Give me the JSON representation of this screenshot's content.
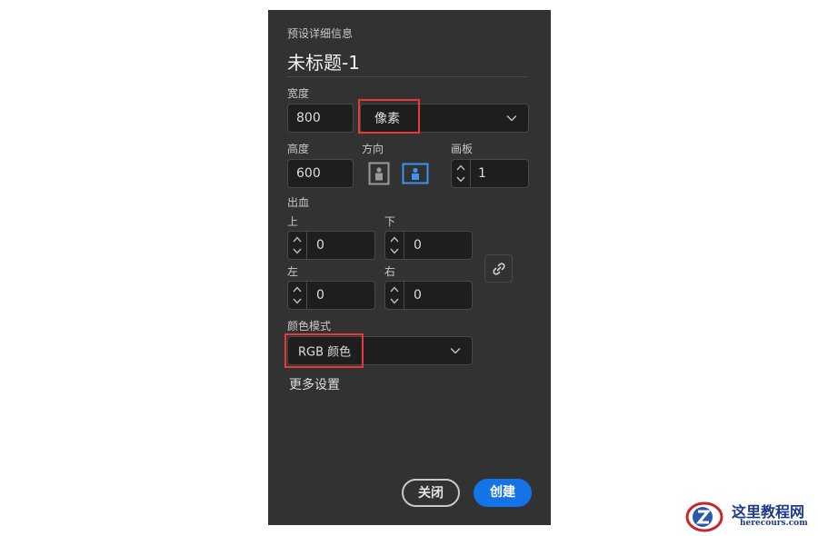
{
  "dialog": {
    "header": "预设详细信息",
    "doc_title": "未标题-1"
  },
  "width": {
    "label": "宽度",
    "value": "800",
    "unit": "像素"
  },
  "height": {
    "label": "高度",
    "value": "600"
  },
  "orientation": {
    "label": "方向",
    "selected": "landscape"
  },
  "artboards": {
    "label": "画板",
    "value": "1"
  },
  "bleed": {
    "label": "出血",
    "top": {
      "label": "上",
      "value": "0"
    },
    "bottom": {
      "label": "下",
      "value": "0"
    },
    "left": {
      "label": "左",
      "value": "0"
    },
    "right": {
      "label": "右",
      "value": "0"
    }
  },
  "color_mode": {
    "label": "颜色模式",
    "value": "RGB 颜色"
  },
  "more_settings": "更多设置",
  "buttons": {
    "close": "关闭",
    "create": "创建"
  },
  "watermark": {
    "title": "这里教程网",
    "url": "herecours.com"
  },
  "colors": {
    "accent": "#1473e6",
    "highlight": "#e53a3a",
    "panel": "#323232"
  }
}
